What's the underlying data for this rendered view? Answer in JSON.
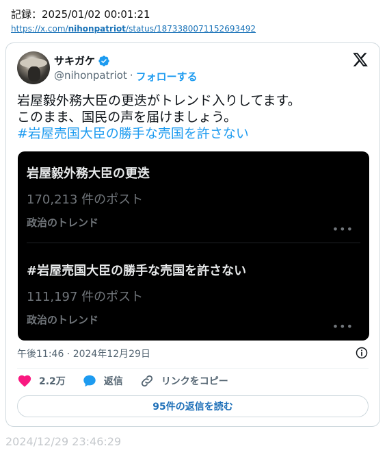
{
  "record": {
    "label": "記録：2025/01/02 00:01:21"
  },
  "source_url": {
    "prefix": "https://x.com/",
    "bold": "nihonpatriot",
    "suffix": "/status/1873380071152693492"
  },
  "post": {
    "author_name": "サキガケ",
    "handle": "@nihonpatriot",
    "separator": "·",
    "follow_label": "フォローする",
    "text_lines": [
      "岩屋毅外務大臣の更迭がトレンド入りしてます。",
      "このまま、国民の声を届けましょう。"
    ],
    "hashtag": "#岩屋売国大臣の勝手な売国を許さない",
    "trends": [
      {
        "title": "岩屋毅外務大臣の更迭",
        "count": "170,213 件のポスト",
        "category": "政治のトレンド",
        "more": "•••"
      },
      {
        "title": "#岩屋売国大臣の勝手な売国を許さない",
        "count": "111,197 件のポスト",
        "category": "政治のトレンド",
        "more": "•••"
      }
    ],
    "timestamp": "午後11:46 · 2024年12月29日",
    "like_count": "2.2万",
    "reply_label": "返信",
    "copy_link_label": "リンクをコピー",
    "read_replies_label": "95件の返信を読む"
  },
  "footer_time": "2024/12/29 23:46:29",
  "colors": {
    "accent": "#1d9bf0",
    "like": "#f91880",
    "media_bg": "#000000"
  },
  "icons": [
    "verified-badge-icon",
    "x-logo-icon",
    "info-icon",
    "heart-icon",
    "reply-bubble-icon",
    "link-icon"
  ]
}
